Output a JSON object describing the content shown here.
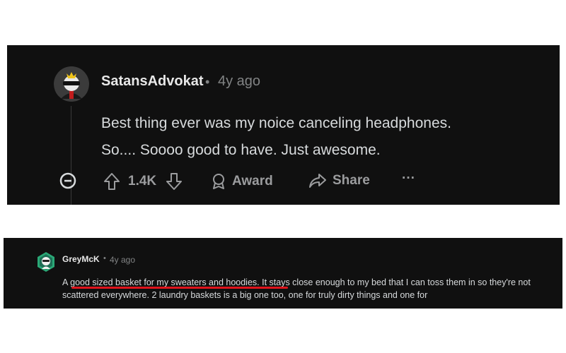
{
  "comment1": {
    "username": "SatansAdvokat",
    "separator": "•",
    "age": "4y ago",
    "body_line1": "Best thing ever was my noice canceling headphones.",
    "body_line2": "So.... Soooo good to have. Just awesome.",
    "actions": {
      "collapse_icon": "minus-circle-icon",
      "upvote_icon": "arrow-up-icon",
      "score": "1.4K",
      "downvote_icon": "arrow-down-icon",
      "award_label": "Award",
      "share_label": "Share",
      "more_label": "···"
    }
  },
  "comment2": {
    "username": "GreyMcK",
    "separator": "•",
    "age": "4y ago",
    "body_prefix": "A ",
    "body_highlight": "good sized basket for my sweaters and hoodies",
    "body_rest": ". It stays close enough to my bed that I can toss them in so they're not scattered everywhere. 2 laundry baskets is a big one too, one for truly dirty things and one for",
    "highlight_color": "#e0141c"
  },
  "colors": {
    "page_bg": "#ffffff",
    "card_bg": "#101010",
    "text_primary": "#d7dadc",
    "text_muted": "#818384"
  }
}
